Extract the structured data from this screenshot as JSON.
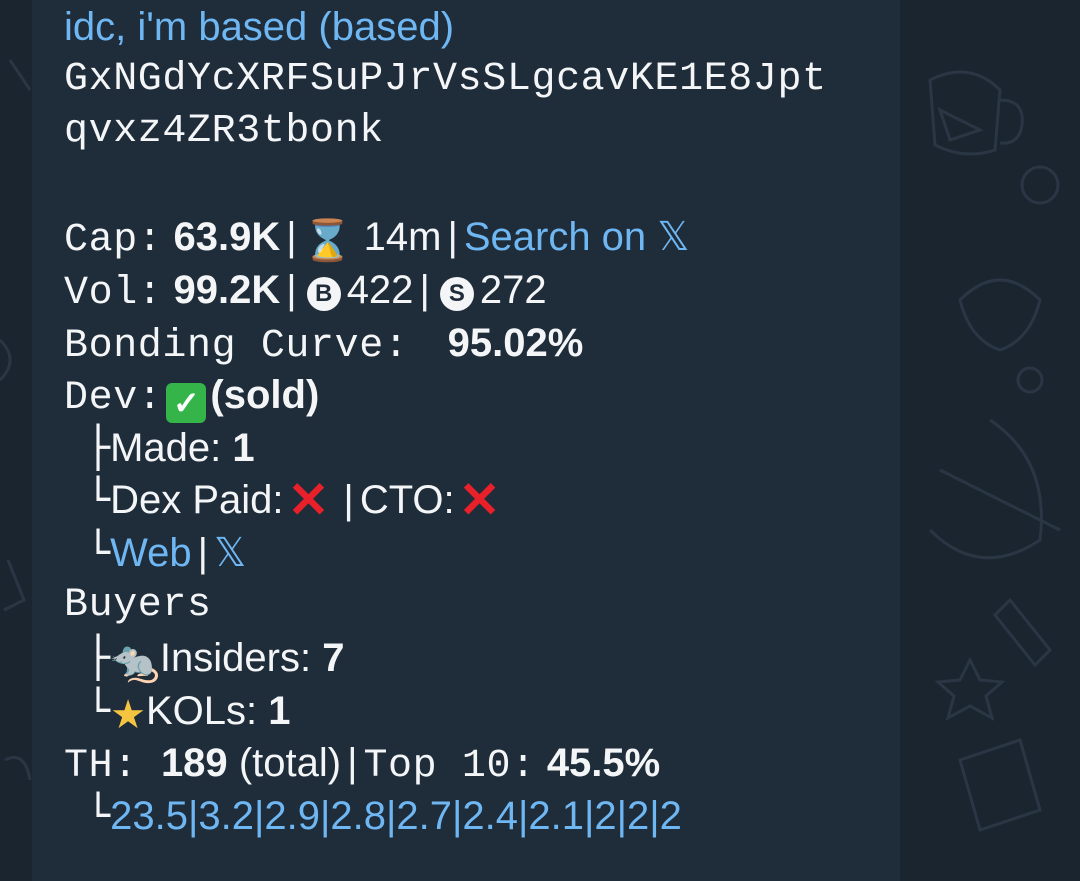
{
  "message": {
    "title": "idc, i'm based (based)",
    "address_line1": "GxNGdYcXRFSuPJrVsSLgcavKE1E8Jpt",
    "address_line2": "qvxz4ZR3tbonk",
    "cap": {
      "label": "Cap:",
      "value": "63.9K",
      "age": "14m",
      "search_link": "Search on 𝕏"
    },
    "vol": {
      "label": "Vol:",
      "value": "99.2K",
      "buy_count": "422",
      "sell_count": "272",
      "buy_symbol": "B",
      "sell_symbol": "S"
    },
    "bonding": {
      "label": "Bonding Curve:",
      "value": "95.02%"
    },
    "dev": {
      "label": "Dev:",
      "status": "(sold)",
      "made_label": "Made:",
      "made_value": "1",
      "dex_paid_label": "Dex Paid:",
      "cto_label": "CTO:",
      "web_link": "Web",
      "x_link": "𝕏"
    },
    "buyers": {
      "label": "Buyers",
      "insiders_label": "Insiders:",
      "insiders_value": "7",
      "kols_label": "KOLs:",
      "kols_value": "1"
    },
    "th": {
      "label": "TH:",
      "total_value": "189",
      "total_suffix": "(total)",
      "top10_label": "Top 10:",
      "top10_value": "45.5%",
      "holders": [
        "23.5",
        "3.2",
        "2.9",
        "2.8",
        "2.7",
        "2.4",
        "2.1",
        "2",
        "2",
        "2"
      ]
    }
  },
  "icons": {
    "hourglass": "hourglass-icon",
    "check": "check-mark-icon",
    "cross": "cross-mark-icon",
    "rat": "rat-icon",
    "star": "glowing-star-icon"
  },
  "colors": {
    "link": "#6fb7f3",
    "bubble": "#1f2c39",
    "background": "#1b2530",
    "text": "#f3f5f7"
  }
}
